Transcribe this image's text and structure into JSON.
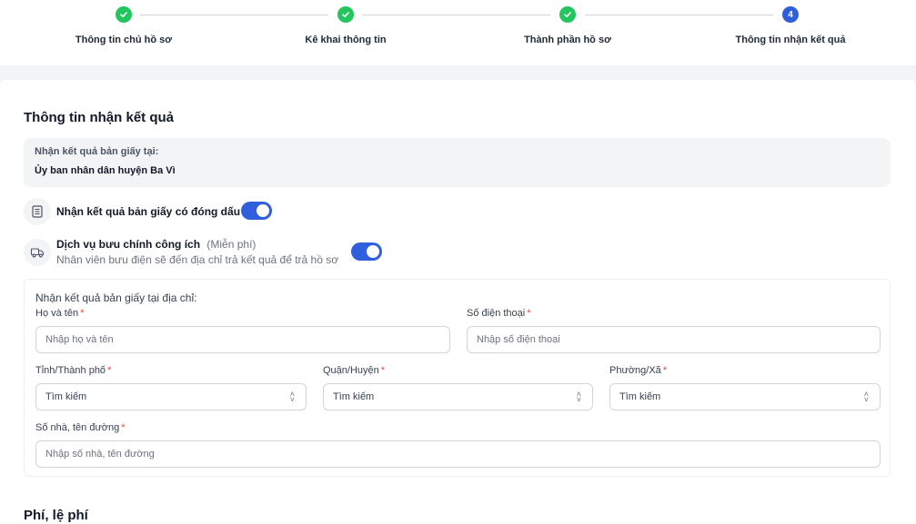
{
  "stepper": {
    "steps": [
      {
        "label": "Thông tin chủ hồ sơ",
        "status": "done"
      },
      {
        "label": "Kê khai thông tin",
        "status": "done"
      },
      {
        "label": "Thành phần hồ sơ",
        "status": "done"
      },
      {
        "label": "Thông tin nhận kết quả",
        "status": "active",
        "number": "4"
      }
    ]
  },
  "section": {
    "title": "Thông tin nhận kết quả",
    "paper_location_label": "Nhận kết quả bản giấy tại:",
    "paper_location_value": "Ủy ban nhân dân huyện Ba Vì"
  },
  "options": {
    "stamped": {
      "title": "Nhận kết quả bản giấy có đóng dấu",
      "icon": "document-icon",
      "enabled": true
    },
    "postal": {
      "title": "Dịch vụ bưu chính công ích",
      "note": "(Miễn phí)",
      "desc": "Nhân viên bưu điện sẽ đến địa chỉ trả kết quả để trả hồ sơ",
      "icon": "delivery-truck-icon",
      "enabled": true
    }
  },
  "address": {
    "caption": "Nhận kết quả bản giấy tại địa chỉ:",
    "fullname": {
      "label": "Họ và tên",
      "placeholder": "Nhập họ và tên"
    },
    "phone": {
      "label": "Số điện thoại",
      "placeholder": "Nhập số điện thoại"
    },
    "province": {
      "label": "Tỉnh/Thành phố",
      "value": "Tìm kiếm"
    },
    "district": {
      "label": "Quận/Huyện",
      "value": "Tìm kiếm"
    },
    "ward": {
      "label": "Phường/Xã",
      "value": "Tìm kiếm"
    },
    "street": {
      "label": "Số nhà, tên đường",
      "placeholder": "Nhập số nhà, tên đường"
    },
    "required_mark": "*"
  },
  "fees": {
    "title": "Phí, lệ phí"
  },
  "colors": {
    "accent": "#2f5fdc",
    "done": "#22c55e",
    "required": "#ef4444"
  }
}
